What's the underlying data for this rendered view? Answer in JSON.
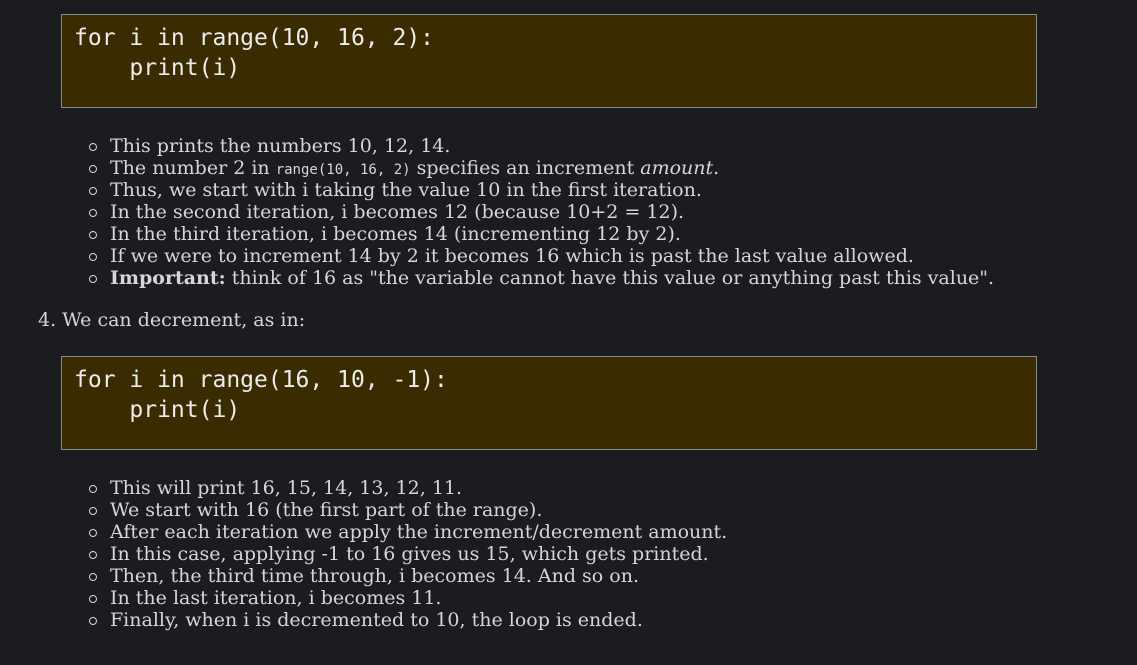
{
  "code_block_1": {
    "line1": "for i in range(10, 16, 2):",
    "line2": "    print(i)"
  },
  "bullets_1": [
    "This prints the numbers 10, 12, 14.",
    {
      "before": "The number 2 in ",
      "code": "range(10, 16, 2)",
      "middle": " specifies an increment ",
      "emph": "amount",
      "after": "."
    },
    "Thus, we start with i taking the value 10 in the first iteration.",
    "In the second iteration, i becomes 12 (because 10+2 = 12).",
    "In the third iteration, i becomes 14 (incrementing 12 by 2).",
    "If we were to increment 14 by 2 it becomes 16 which is past the last value allowed.",
    {
      "bold": "Important:",
      "rest": " think of 16 as \"the variable cannot have this value or anything past this value\"."
    }
  ],
  "step_4": {
    "number": "4.",
    "text": " We can decrement, as in:"
  },
  "code_block_2": {
    "line1": "for i in range(16, 10, -1):",
    "line2": "    print(i)"
  },
  "bullets_2": [
    "This will print 16, 15, 14, 13, 12, 11.",
    "We start with 16 (the first part of the range).",
    "After each iteration we apply the increment/decrement amount.",
    "In this case, applying -1 to 16 gives us 15, which gets printed.",
    "Then, the third time through, i becomes 14. And so on.",
    "In the last iteration, i becomes 11.",
    "Finally, when i is decremented to 10, the loop is ended."
  ]
}
